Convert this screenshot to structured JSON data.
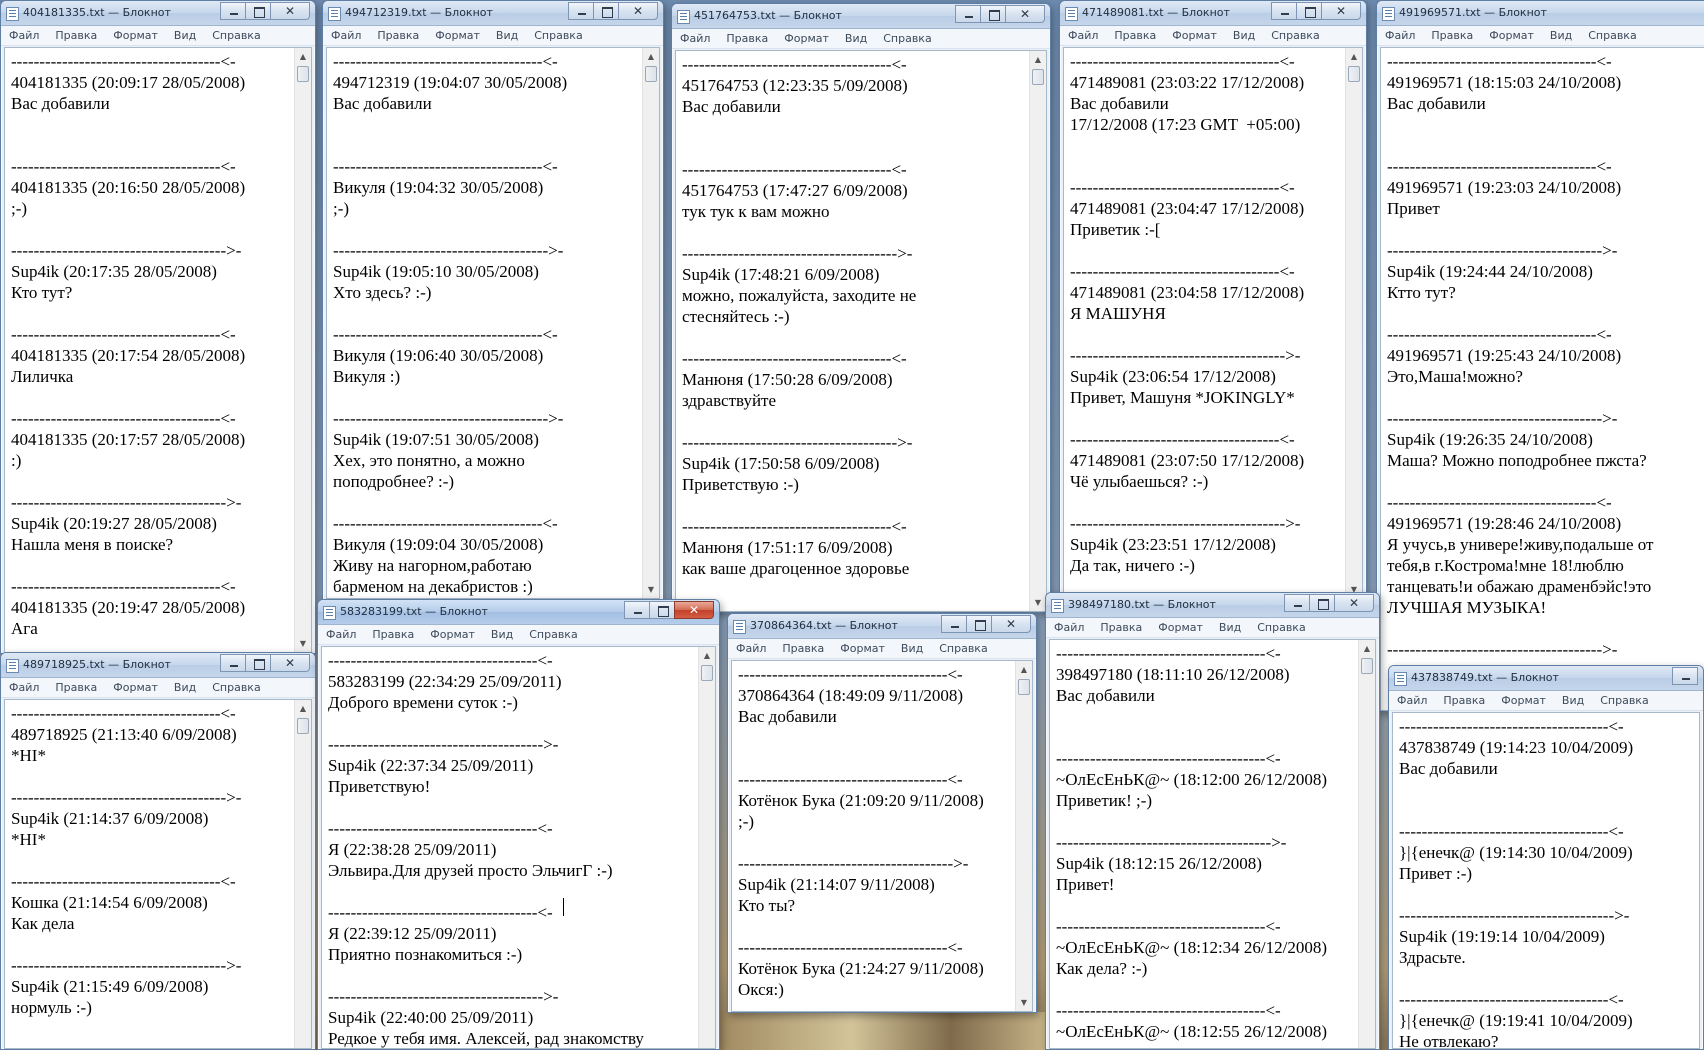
{
  "menu": [
    "Файл",
    "Правка",
    "Формат",
    "Вид",
    "Справка"
  ],
  "windows": [
    {
      "title": "404181335.txt — Блокнот",
      "text": "-------------------------------------<-\n404181335 (20:09:17 28/05/2008)\nВас добавили\n\n\n-------------------------------------<-\n404181335 (20:16:50 28/05/2008)\n;-)\n\n-------------------------------------->-\nSup4ik (20:17:35 28/05/2008)\nКто тут?\n\n-------------------------------------<-\n404181335 (20:17:54 28/05/2008)\nЛиличка\n\n-------------------------------------<-\n404181335 (20:17:57 28/05/2008)\n:)\n\n-------------------------------------->-\nSup4ik (20:19:27 28/05/2008)\nНашла меня в поиске?\n\n-------------------------------------<-\n404181335 (20:19:47 28/05/2008)\nАга"
    },
    {
      "title": "494712319.txt — Блокнот",
      "text": "-------------------------------------<-\n494712319 (19:04:07 30/05/2008)\nВас добавили\n\n\n-------------------------------------<-\nВикуля (19:04:32 30/05/2008)\n;-)\n\n-------------------------------------->-\nSup4ik (19:05:10 30/05/2008)\nХто здесь? :-)\n\n-------------------------------------<-\nВикуля (19:06:40 30/05/2008)\nВикуля :)\n\n-------------------------------------->-\nSup4ik (19:07:51 30/05/2008)\nХех, это понятно, а можно\nпоподробнее? :-)\n\n-------------------------------------<-\nВикуля (19:09:04 30/05/2008)\nЖиву на нагорном,работаю\nбарменом на декабристов :)"
    },
    {
      "title": "451764753.txt — Блокнот",
      "text": "-------------------------------------<-\n451764753 (12:23:35 5/09/2008)\nВас добавили\n\n\n-------------------------------------<-\n451764753 (17:47:27 6/09/2008)\nтук тук к вам можно\n\n-------------------------------------->-\nSup4ik (17:48:21 6/09/2008)\nможно, пожалуйста, заходите не\nстесняйтесь :-)\n\n-------------------------------------<-\nМанюня (17:50:28 6/09/2008)\nздравствуйте\n\n-------------------------------------->-\nSup4ik (17:50:58 6/09/2008)\nПриветствую :-)\n\n-------------------------------------<-\nМанюня (17:51:17 6/09/2008)\nкак ваше драгоценное здоровье"
    },
    {
      "title": "471489081.txt — Блокнот",
      "text": "-------------------------------------<-\n471489081 (23:03:22 17/12/2008)\nВас добавили\n17/12/2008 (17:23 GMT  +05:00)\n\n\n-------------------------------------<-\n471489081 (23:04:47 17/12/2008)\nПриветик :-[\n\n-------------------------------------<-\n471489081 (23:04:58 17/12/2008)\nЯ МАШУНЯ\n\n-------------------------------------->-\nSup4ik (23:06:54 17/12/2008)\nПривет, Машуня *JOKINGLY*\n\n-------------------------------------<-\n471489081 (23:07:50 17/12/2008)\nЧё улыбаешься? :-)\n\n-------------------------------------->-\nSup4ik (23:23:51 17/12/2008)\nДа так, ничего :-)"
    },
    {
      "title": "491969571.txt — Блокнот",
      "text": "-------------------------------------<-\n491969571 (18:15:03 24/10/2008)\nВас добавили\n\n\n-------------------------------------<-\n491969571 (19:23:03 24/10/2008)\nПривет\n\n-------------------------------------->-\nSup4ik (19:24:44 24/10/2008)\nКтто тут?\n\n-------------------------------------<-\n491969571 (19:25:43 24/10/2008)\nЭто,Маша!можно?\n\n-------------------------------------->-\nSup4ik (19:26:35 24/10/2008)\nМаша? Можно поподробнее пжста?\n\n-------------------------------------<-\n491969571 (19:28:46 24/10/2008)\nЯ учусь,в универе!живу,подальше от\nтебя,в г.Кострома!мне 18!люблю\nтанцевать!и обажаю драменбэйс!это\nЛУЧШАЯ МУЗЫКА!\n\n-------------------------------------->-"
    },
    {
      "title": "489718925.txt — Блокнот",
      "text": "-------------------------------------<-\n489718925 (21:13:40 6/09/2008)\n*HI*\n\n-------------------------------------->-\nSup4ik (21:14:37 6/09/2008)\n*HI*\n\n-------------------------------------<-\nКошка (21:14:54 6/09/2008)\nКак дела\n\n-------------------------------------->-\nSup4ik (21:15:49 6/09/2008)\nнормуль :-)"
    },
    {
      "title": "583283199.txt — Блокнот",
      "text": "-------------------------------------<-\n583283199 (22:34:29 25/09/2011)\nДоброго времени суток :-)\n\n-------------------------------------->-\nSup4ik (22:37:34 25/09/2011)\nПриветствую!\n\n-------------------------------------<-\nЯ (22:38:28 25/09/2011)\nЭльвира.Для друзей просто ЭльчигГ :-)\n\n-------------------------------------<-\nЯ (22:39:12 25/09/2011)\nПриятно познакомиться :-)\n\n-------------------------------------->-\nSup4ik (22:40:00 25/09/2011)\nРедкое у тебя имя. Алексей, рад знакомству"
    },
    {
      "title": "370864364.txt — Блокнот",
      "text": "-------------------------------------<-\n370864364 (18:49:09 9/11/2008)\nВас добавили\n\n\n-------------------------------------<-\nКотёнок Бука (21:09:20 9/11/2008)\n;-)\n\n-------------------------------------->-\nSup4ik (21:14:07 9/11/2008)\nКто ты?\n\n-------------------------------------<-\nКотёнок Бука (21:24:27 9/11/2008)\nОкся:)"
    },
    {
      "title": "398497180.txt — Блокнот",
      "text": "-------------------------------------<-\n398497180 (18:11:10 26/12/2008)\nВас добавили\n\n\n-------------------------------------<-\n~ОлЕсЕнЬК@~ (18:12:00 26/12/2008)\nПриветик! ;-)\n\n-------------------------------------->-\nSup4ik (18:12:15 26/12/2008)\nПривет!\n\n-------------------------------------<-\n~ОлЕсЕнЬК@~ (18:12:34 26/12/2008)\nКак дела? :-)\n\n-------------------------------------<-\n~ОлЕсЕнЬК@~ (18:12:55 26/12/2008)"
    },
    {
      "title": "437838749.txt — Блокнот",
      "text": "-------------------------------------<-\n437838749 (19:14:23 10/04/2009)\nВас добавили\n\n\n-------------------------------------<-\n}|{енечк@ (19:14:30 10/04/2009)\nПривет :-)\n\n-------------------------------------->-\nSup4ik (19:19:14 10/04/2009)\nЗдрасьте.\n\n-------------------------------------<-\n}|{енечк@ (19:19:41 10/04/2009)\nНе отвлекаю?"
    }
  ]
}
